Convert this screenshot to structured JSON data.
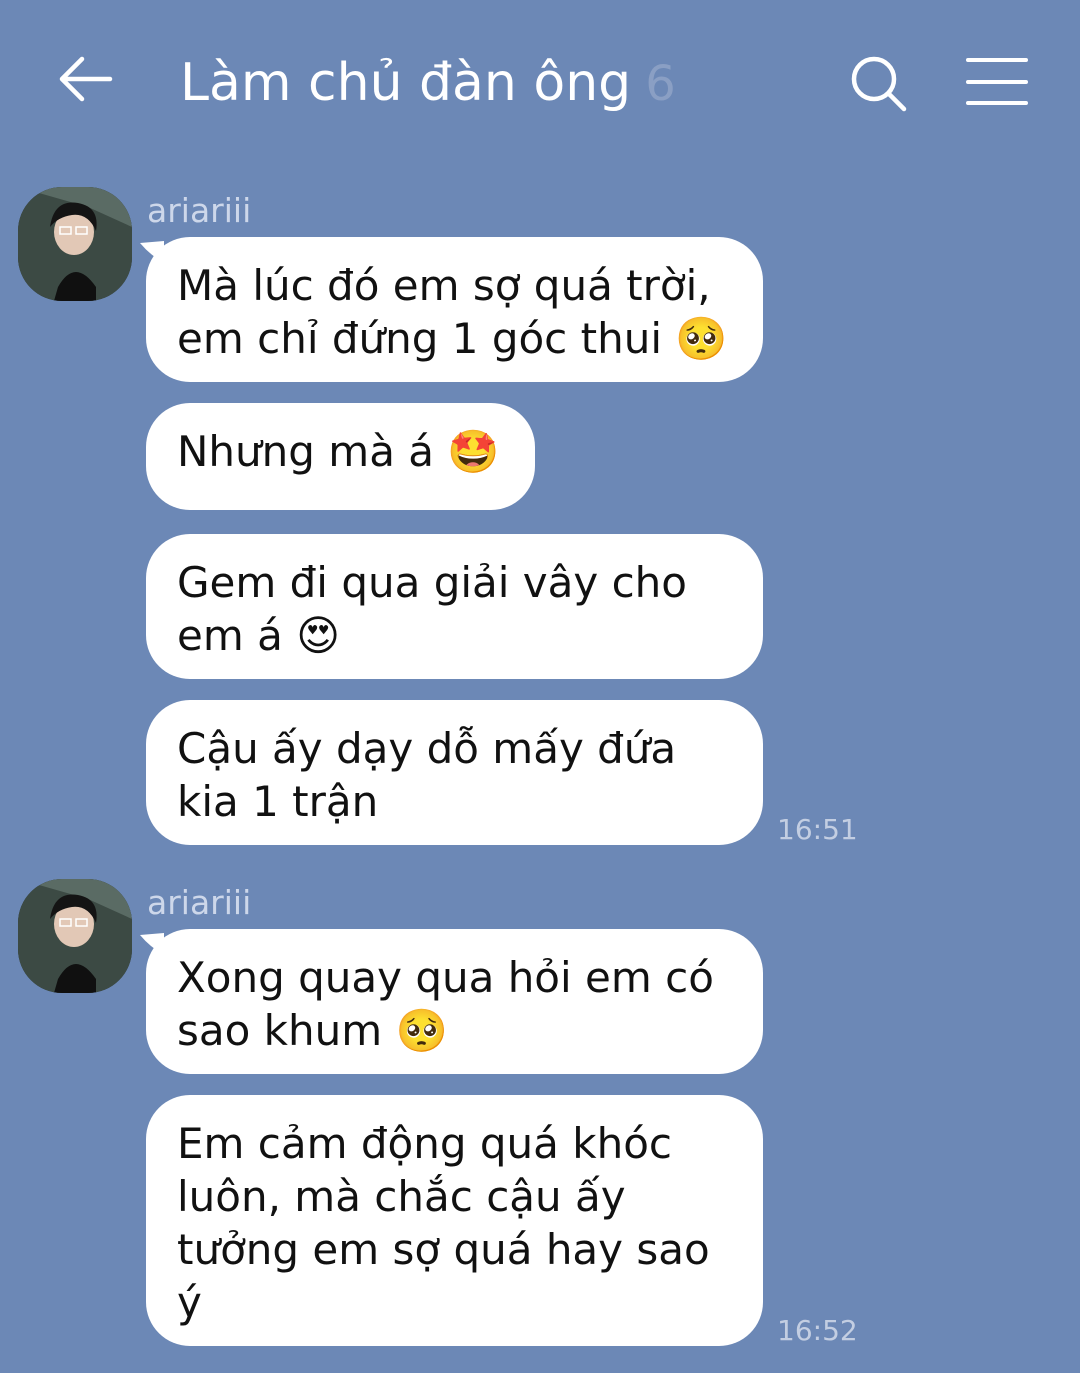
{
  "header": {
    "title": "Làm chủ đàn ông",
    "member_count": "6",
    "back_icon": "back-arrow-icon",
    "search_icon": "search-icon",
    "menu_icon": "menu-icon"
  },
  "colors": {
    "background": "#6c88b6",
    "bubble": "#ffffff",
    "text": "#111111"
  },
  "groups": [
    {
      "sender": "ariariii",
      "messages": [
        {
          "text": "Mà lúc đó em sợ quá trời,\nem chỉ đứng 1 góc thui 🥺"
        },
        {
          "text": "Nhưng mà á 🤩"
        },
        {
          "text": "Gem đi qua giải vây cho\nem á 😍"
        },
        {
          "text": "Cậu ấy dạy dỗ mấy đứa\nkia 1 trận"
        }
      ],
      "time": "16:51"
    },
    {
      "sender": "ariariii",
      "messages": [
        {
          "text": "Xong quay qua hỏi em có\nsao khum 🥺"
        },
        {
          "text": "Em cảm động quá khóc\nluôn, mà chắc cậu ấy\ntưởng em sợ quá hay sao\ný"
        }
      ],
      "time": "16:52"
    }
  ]
}
